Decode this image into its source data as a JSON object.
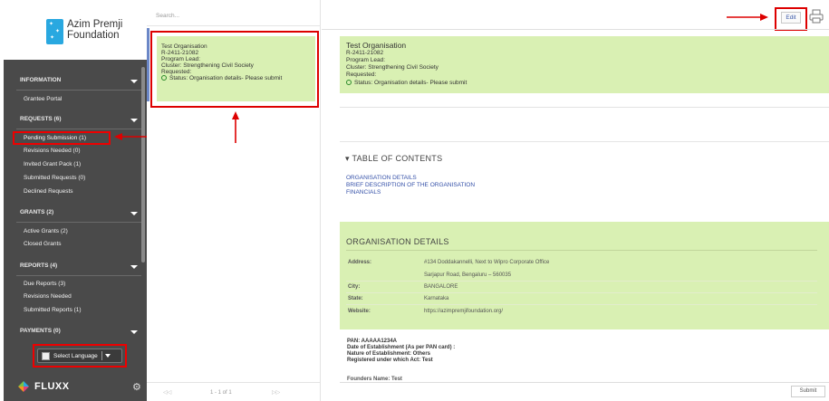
{
  "brand": {
    "org_name_line1": "Azim Premji",
    "org_name_line2": "Foundation",
    "fluxx_label": "FLUXX"
  },
  "sidebar": {
    "sections": [
      {
        "title": "INFORMATION",
        "items": [
          "Grantee Portal"
        ]
      },
      {
        "title": "REQUESTS (6)",
        "items": [
          "Pending Submission (1)",
          "Revisions Needed (0)",
          "Invited Grant Pack (1)",
          "Submitted Requests (0)",
          "Declined Requests"
        ]
      },
      {
        "title": "GRANTS (2)",
        "items": [
          "Active Grants (2)",
          "Closed Grants"
        ]
      },
      {
        "title": "REPORTS (4)",
        "items": [
          "Due Reports (3)",
          "Revisions Needed",
          "Submitted Reports (1)"
        ]
      },
      {
        "title": "PAYMENTS (0)",
        "items": []
      }
    ],
    "language_button": "Select Language"
  },
  "list": {
    "search_placeholder": "Search...",
    "card": {
      "name": "Test Organisation",
      "id": "R-2411-21082",
      "lead": "Program Lead:",
      "cluster": "Cluster: Strengthening Civil Society",
      "requested": "Requested:",
      "status": "Status: Organisation details- Please submit"
    },
    "pager": {
      "first": "◁◁",
      "count": "1 - 1 of 1",
      "last": "▷▷"
    }
  },
  "detail": {
    "edit_label": "Edit",
    "header": {
      "name": "Test Organisation",
      "id": "R-2411-21082",
      "lead": "Program Lead:",
      "cluster": "Cluster: Strengthening Civil Society",
      "requested": "Requested:",
      "status": "Status: Organisation details- Please submit"
    },
    "toc": {
      "title": "▾ TABLE OF CONTENTS",
      "links": [
        "ORGANISATION DETAILS",
        "BRIEF DESCRIPTION OF THE ORGANISATION",
        "FINANCIALS"
      ]
    },
    "org": {
      "title": "ORGANISATION DETAILS",
      "fields": {
        "address_label": "Address:",
        "address_line1": "#134 Doddakannelli, Next to Wipro Corporate Office",
        "address_line2": "Sarjapur Road, Bengaluru – 560035",
        "city_label": "City:",
        "city": "BANGALORE",
        "state_label": "State:",
        "state": "Karnataka",
        "website_label": "Website:",
        "website": "https://azimpremjifoundation.org/"
      },
      "extra": {
        "pan": "PAN: AAAAA1234A",
        "establishment_date": "Date of Establishment (As per PAN card) :",
        "nature": "Nature of Establishment: Others",
        "registered_act": "Registered under which Act: Test",
        "founders": "Founders Name: Test"
      }
    },
    "submit_label": "Submit"
  },
  "colors": {
    "sidebar_bg": "#4a4a4a",
    "card_green": "#d9f0b3",
    "link_blue": "#3450a8",
    "annotation_red": "#dd0000"
  }
}
